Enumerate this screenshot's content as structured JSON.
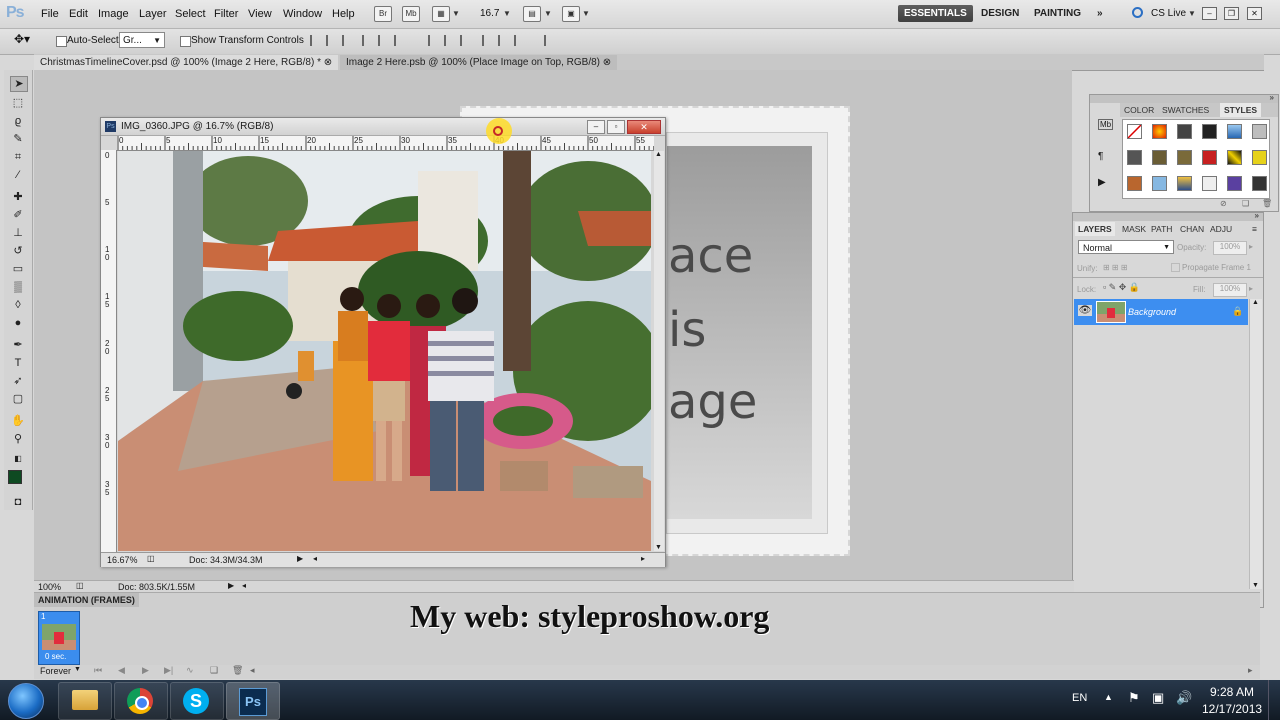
{
  "app": {
    "logo": "Ps"
  },
  "menubar": {
    "items": [
      "File",
      "Edit",
      "Image",
      "Layer",
      "Select",
      "Filter",
      "View",
      "Window",
      "Help"
    ],
    "zoom": "16.7",
    "workspaces": [
      "ESSENTIALS",
      "DESIGN",
      "PAINTING"
    ],
    "cs_live": "CS Live"
  },
  "options_bar": {
    "auto_select_label": "Auto-Select:",
    "auto_select_value": "Gr...",
    "transform_label": "Show Transform Controls"
  },
  "tabs": [
    {
      "label": "ChristmasTimelineCover.psd @ 100% (Image 2 Here, RGB/8) *"
    },
    {
      "label": "Image 2 Here.psb @ 100% (Place Image on Top, RGB/8)"
    }
  ],
  "canvas": {
    "placeholder_lines": [
      "ace",
      "is",
      "age"
    ]
  },
  "image_window": {
    "title": "IMG_0360.JPG @ 16.7% (RGB/8)",
    "ruler_top": [
      "0",
      "5",
      "10",
      "15",
      "20",
      "25",
      "30",
      "35",
      "40",
      "45",
      "50",
      "55"
    ],
    "ruler_left": [
      "0",
      "5",
      "1\n0",
      "1\n5",
      "2\n0",
      "2\n5",
      "3\n0",
      "3\n5"
    ],
    "status_zoom": "16.67%",
    "status_doc": "Doc: 34.3M/34.3M"
  },
  "styles_panel": {
    "tabs": [
      "COLOR",
      "SWATCHES",
      "STYLES"
    ],
    "active_tab": "STYLES"
  },
  "layers_panel": {
    "tabs": [
      "LAYERS",
      "MASK",
      "PATH",
      "CHAN",
      "ADJU"
    ],
    "blend_mode": "Normal",
    "opacity_label": "Opacity:",
    "opacity_value": "100%",
    "unify_label": "Unify:",
    "propagate_label": "Propagate Frame 1",
    "lock_label": "Lock:",
    "fill_label": "Fill:",
    "fill_value": "100%",
    "layer_name": "Background"
  },
  "main_status": {
    "zoom": "100%",
    "doc": "Doc: 803.5K/1.55M"
  },
  "animation_panel": {
    "tab": "ANIMATION (FRAMES)",
    "frame_number": "1",
    "frame_delay": "0 sec.",
    "loop": "Forever"
  },
  "watermark": "My web: styleproshow.org",
  "taskbar": {
    "language": "EN",
    "time": "9:28 AM",
    "date": "12/17/2013"
  },
  "colors": {
    "foreground": "#0e4a22",
    "selection": "#3d8ef0",
    "taskbar": "#1b2735"
  }
}
